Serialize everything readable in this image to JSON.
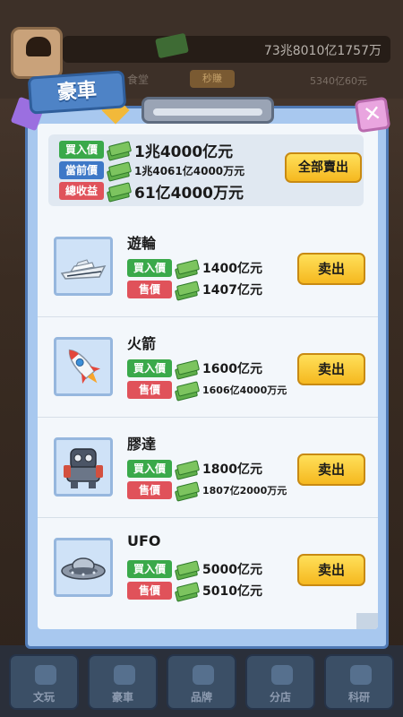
{
  "background": {
    "total_money": "73兆8010亿1757万",
    "label_partial": "食堂",
    "button_partial": "秒賺",
    "value_partial": "5340亿60元"
  },
  "modal": {
    "title": "豪車",
    "close_symbol": "✕"
  },
  "summary": {
    "buy_label": "買入價",
    "buy_value": "1兆4000亿元",
    "current_label": "當前價",
    "current_value": "1兆4061亿4000万元",
    "profit_label": "總收益",
    "profit_value": "61亿4000万元",
    "sell_all_label": "全部賣出"
  },
  "items": [
    {
      "name": "遊輪",
      "buy_label": "買入價",
      "buy_price": "1400亿元",
      "sell_label": "售價",
      "sell_price": "1407亿元",
      "button": "卖出",
      "icon": "yacht-icon"
    },
    {
      "name": "火箭",
      "buy_label": "買入價",
      "buy_price": "1600亿元",
      "sell_label": "售價",
      "sell_price": "1606亿4000万元",
      "button": "卖出",
      "icon": "rocket-icon"
    },
    {
      "name": "膠達",
      "buy_label": "買入價",
      "buy_price": "1800亿元",
      "sell_label": "售價",
      "sell_price": "1807亿2000万元",
      "button": "卖出",
      "icon": "robot-icon"
    },
    {
      "name": "UFO",
      "buy_label": "買入價",
      "buy_price": "5000亿元",
      "sell_label": "售價",
      "sell_price": "5010亿元",
      "button": "卖出",
      "icon": "ufo-icon"
    }
  ],
  "bottom_nav": [
    {
      "label": "文玩",
      "icon": "antique-icon"
    },
    {
      "label": "豪車",
      "icon": "car-icon"
    },
    {
      "label": "品牌",
      "icon": "brand-icon"
    },
    {
      "label": "分店",
      "icon": "store-icon"
    },
    {
      "label": "科研",
      "icon": "research-icon"
    }
  ],
  "colors": {
    "buy_tag": "#3aa94a",
    "current_tag": "#3e78c7",
    "sell_tag": "#e0525a",
    "button_yellow": "#f5b81f",
    "modal_blue": "#4e83c6"
  }
}
